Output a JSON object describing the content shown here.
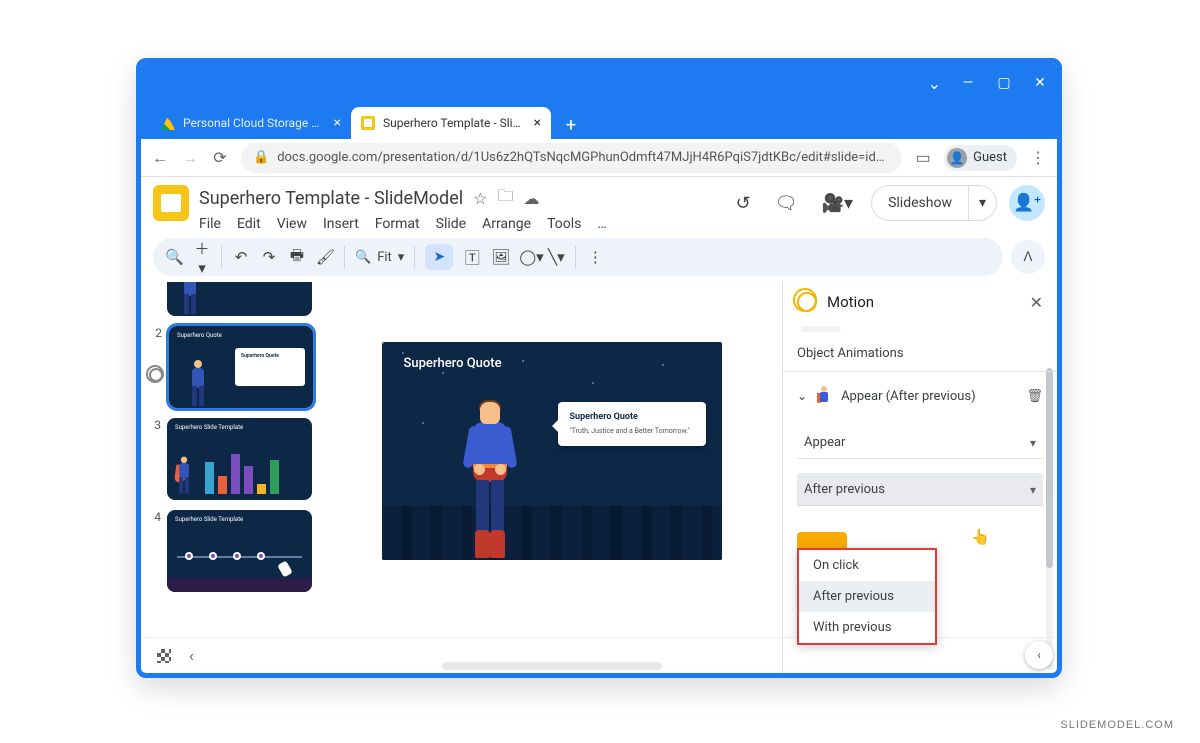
{
  "browser": {
    "tabs": [
      {
        "label": "Personal Cloud Storage & File Sh"
      },
      {
        "label": "Superhero Template - SlideModel"
      }
    ],
    "url": "docs.google.com/presentation/d/1Us6z2hQTsNqcMGPhunOdmft47MJjH4R6PqiS7jdtKBc/edit#slide=id…",
    "guest": "Guest"
  },
  "doc": {
    "title": "Superhero Template - SlideModel",
    "menus": [
      "File",
      "Edit",
      "View",
      "Insert",
      "Format",
      "Slide",
      "Arrange",
      "Tools"
    ],
    "menus_more": "…",
    "slideshow": "Slideshow"
  },
  "toolbar": {
    "zoom": "Fit"
  },
  "thumbs": [
    {
      "num": "",
      "label": ""
    },
    {
      "num": "2",
      "label": "Superhero Quote"
    },
    {
      "num": "3",
      "label": "Superhero Slide Template"
    },
    {
      "num": "4",
      "label": "Superhero Slide Template"
    }
  ],
  "canvas": {
    "title": "Superhero Quote",
    "bubble_title": "Superhero Quote",
    "bubble_body": "\"Truth, Justice and a Better Tomorrow.\""
  },
  "motion": {
    "title": "Motion",
    "section": "Object Animations",
    "item_label": "Appear  (After previous)",
    "dd_effect": "Appear",
    "dd_trigger": "After previous",
    "options": [
      "On click",
      "After previous",
      "With previous"
    ]
  },
  "watermark": "SLIDEMODEL.COM"
}
